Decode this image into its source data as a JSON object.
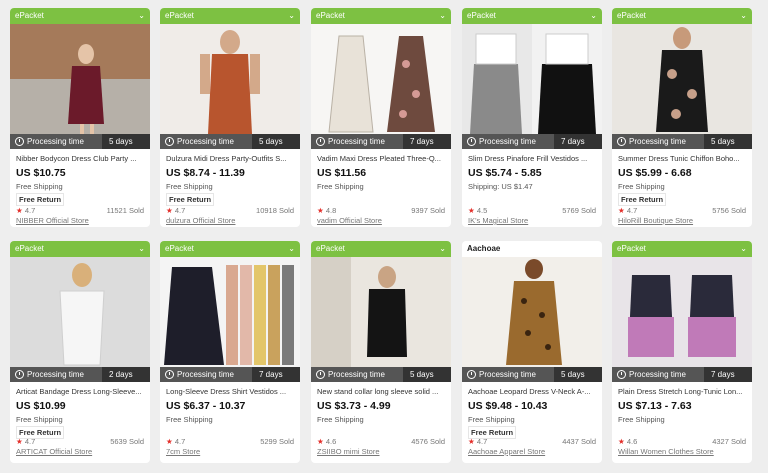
{
  "products": [
    {
      "badge": "ePacket",
      "processing_label": "Processing time",
      "processing_days": "5 days",
      "title": "Nibber Bodycon Dress Club Party ...",
      "price": "US $10.75",
      "shipping": "Free Shipping",
      "free_return": "Free Return",
      "rating": "4.7",
      "sold": "11521 Sold",
      "store": "NIBBER Official Store",
      "photo_colors": [
        "#6b1a2a",
        "#c9b9a8"
      ]
    },
    {
      "badge": "ePacket",
      "processing_label": "Processing time",
      "processing_days": "5 days",
      "title": "Dulzura Midi Dress Party-Outfits S...",
      "price": "US $8.74 - 11.39",
      "shipping": "Free Shipping",
      "free_return": "Free Return",
      "rating": "4.7",
      "sold": "10918 Sold",
      "store": "dulzura Official Store",
      "photo_colors": [
        "#b8552e",
        "#f0ece8"
      ]
    },
    {
      "badge": "ePacket",
      "processing_label": "Processing time",
      "processing_days": "7 days",
      "title": "Vadim Maxi Dress Pleated Three-Q...",
      "price": "US $11.56",
      "shipping": "Free Shipping",
      "free_return": "",
      "rating": "4.8",
      "sold": "9397 Sold",
      "store": "vadim Official Store",
      "photo_colors": [
        "#e8e2d8",
        "#6e4a3e"
      ]
    },
    {
      "badge": "ePacket",
      "processing_label": "Processing time",
      "processing_days": "7 days",
      "title": "Slim Dress Pinafore Frill Vestidos ...",
      "price": "US $5.74 - 5.85",
      "shipping": "Shipping: US $1.47",
      "free_return": "",
      "rating": "4.5",
      "sold": "5769 Sold",
      "store": "IK's Magical Store",
      "photo_colors": [
        "#8a8a8a",
        "#111111"
      ]
    },
    {
      "badge": "ePacket",
      "processing_label": "Processing time",
      "processing_days": "5 days",
      "title": "Summer Dress Tunic Chiffon Boho...",
      "price": "US $5.99 - 6.68",
      "shipping": "Free Shipping",
      "free_return": "Free Return",
      "rating": "4.7",
      "sold": "5756 Sold",
      "store": "HiloRill Boutique Store",
      "photo_colors": [
        "#1a1a1a",
        "#e9e6e1"
      ]
    },
    {
      "badge": "ePacket",
      "processing_label": "Processing time",
      "processing_days": "2 days",
      "title": "Articat Bandage Dress Long-Sleeve...",
      "price": "US $10.99",
      "shipping": "Free Shipping",
      "free_return": "Free Return",
      "rating": "4.7",
      "sold": "5639 Sold",
      "store": "ARTICAT Official Store",
      "photo_colors": [
        "#f6f6f6",
        "#dcdcdc"
      ]
    },
    {
      "badge": "ePacket",
      "processing_label": "Processing time",
      "processing_days": "7 days",
      "title": "Long-Sleeve Dress Shirt Vestidos ...",
      "price": "US $6.37 - 10.37",
      "shipping": "Free Shipping",
      "free_return": "",
      "rating": "4.7",
      "sold": "5299 Sold",
      "store": "7cm Store",
      "photo_colors": [
        "#1e1e2a",
        "#d9a890"
      ]
    },
    {
      "badge": "ePacket",
      "processing_label": "Processing time",
      "processing_days": "5 days",
      "title": "New stand collar long sleeve solid ...",
      "price": "US $3.73 - 4.99",
      "shipping": "Free Shipping",
      "free_return": "",
      "rating": "4.6",
      "sold": "4576 Sold",
      "store": "ZSIIBO mimi Store",
      "photo_colors": [
        "#141414",
        "#eae6df"
      ]
    },
    {
      "badge": "Aachoae",
      "processing_label": "Processing time",
      "processing_days": "5 days",
      "title": "Aachoae Leopard Dress V-Neck A-...",
      "price": "US $9.48 - 10.43",
      "shipping": "Free Shipping",
      "free_return": "Free Return",
      "rating": "4.7",
      "sold": "4437 Sold",
      "store": "Aachoae Apparel Store",
      "photo_colors": [
        "#9a6a2e",
        "#f2efea"
      ]
    },
    {
      "badge": "ePacket",
      "processing_label": "Processing time",
      "processing_days": "7 days",
      "title": "Plain Dress Stretch Long-Tunic Lon...",
      "price": "US $7.13 - 7.63",
      "shipping": "Free Shipping",
      "free_return": "",
      "rating": "4.6",
      "sold": "4327 Sold",
      "store": "Willan Women Clothes Store",
      "photo_colors": [
        "#2a2a3a",
        "#c07ab8"
      ]
    }
  ],
  "icons": {
    "star": "star-icon",
    "clock": "clock-icon",
    "chevron": "chevron-down-icon"
  }
}
